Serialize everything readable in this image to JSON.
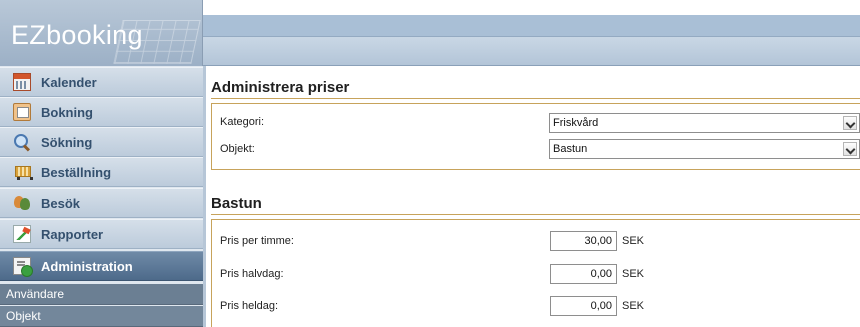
{
  "app": {
    "logo_text": "EZbooking"
  },
  "sidebar": {
    "items": [
      {
        "label": "Kalender",
        "icon": "calendar-icon"
      },
      {
        "label": "Bokning",
        "icon": "booking-icon"
      },
      {
        "label": "Sökning",
        "icon": "search-icon"
      },
      {
        "label": "Beställning",
        "icon": "cart-icon"
      },
      {
        "label": "Besök",
        "icon": "visitors-icon"
      },
      {
        "label": "Rapporter",
        "icon": "report-chart-icon"
      },
      {
        "label": "Administration",
        "icon": "admin-icon",
        "active": true
      }
    ],
    "sub_items": [
      {
        "label": "Användare"
      },
      {
        "label": "Objekt"
      }
    ]
  },
  "prices_section": {
    "title": "Administrera priser",
    "category_label": "Kategori:",
    "category_value": "Friskvård",
    "object_label": "Objekt:",
    "object_value": "Bastun"
  },
  "object_section": {
    "title": "Bastun",
    "rows": [
      {
        "label": "Pris per timme:",
        "value": "30,00",
        "unit": "SEK"
      },
      {
        "label": "Pris halvdag:",
        "value": "0,00",
        "unit": "SEK"
      },
      {
        "label": "Pris heldag:",
        "value": "0,00",
        "unit": "SEK"
      }
    ]
  },
  "colors": {
    "sidebar_active": "#4d6a8a",
    "panel_border": "#c7a35b",
    "header_bar": "#a9bfd6"
  }
}
